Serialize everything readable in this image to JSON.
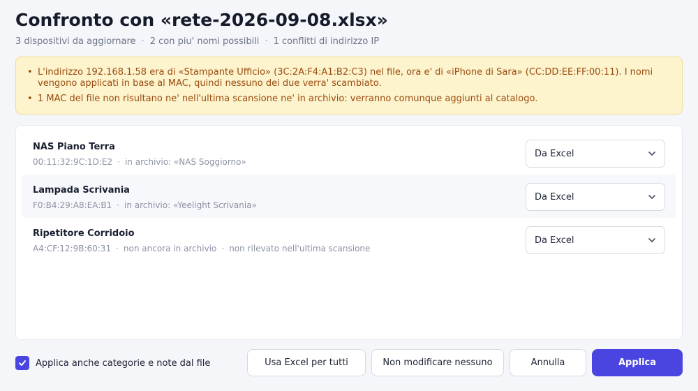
{
  "header": {
    "title": "Confronto con «rete-2026-09-08.xlsx»",
    "summary": [
      "3 dispositivi da aggiornare",
      "2 con piu' nomi possibili",
      "1 conflitti di indirizzo IP"
    ],
    "separator": "·"
  },
  "warnings": [
    "L'indirizzo 192.168.1.58 era di «Stampante Ufficio» (3C:2A:F4:A1:B2:C3) nel file, ora e' di «iPhone di Sara» (CC:DD:EE:FF:00:11). I nomi vengono applicati in base al MAC, quindi nessuno dei due verra' scambiato.",
    "1 MAC del file non risultano ne' nell'ultima scansione ne' in archivio: verranno comunque aggiunti al catalogo."
  ],
  "devices": [
    {
      "name": "NAS Piano Terra",
      "meta": [
        "00:11:32:9C:1D:E2",
        "in archivio: «NAS Soggiorno»"
      ],
      "choice": "Da Excel"
    },
    {
      "name": "Lampada Scrivania",
      "meta": [
        "F0:B4:29:A8:EA:B1",
        "in archivio: «Yeelight Scrivania»"
      ],
      "choice": "Da Excel"
    },
    {
      "name": "Ripetitore Corridoio",
      "meta": [
        "A4:CF:12:9B:60:31",
        "non ancora in archivio",
        "non rilevato nell'ultima scansione"
      ],
      "choice": "Da Excel"
    }
  ],
  "footer": {
    "apply_extra_label": "Applica anche categorie e note dal file",
    "apply_extra_checked": true,
    "use_excel_all": "Usa Excel per tutti",
    "modify_none": "Non modificare nessuno",
    "cancel": "Annulla",
    "apply": "Applica"
  },
  "colors": {
    "accent": "#4a45e0",
    "warning_bg": "#fdf3cd",
    "warning_text": "#9a4b0e"
  }
}
